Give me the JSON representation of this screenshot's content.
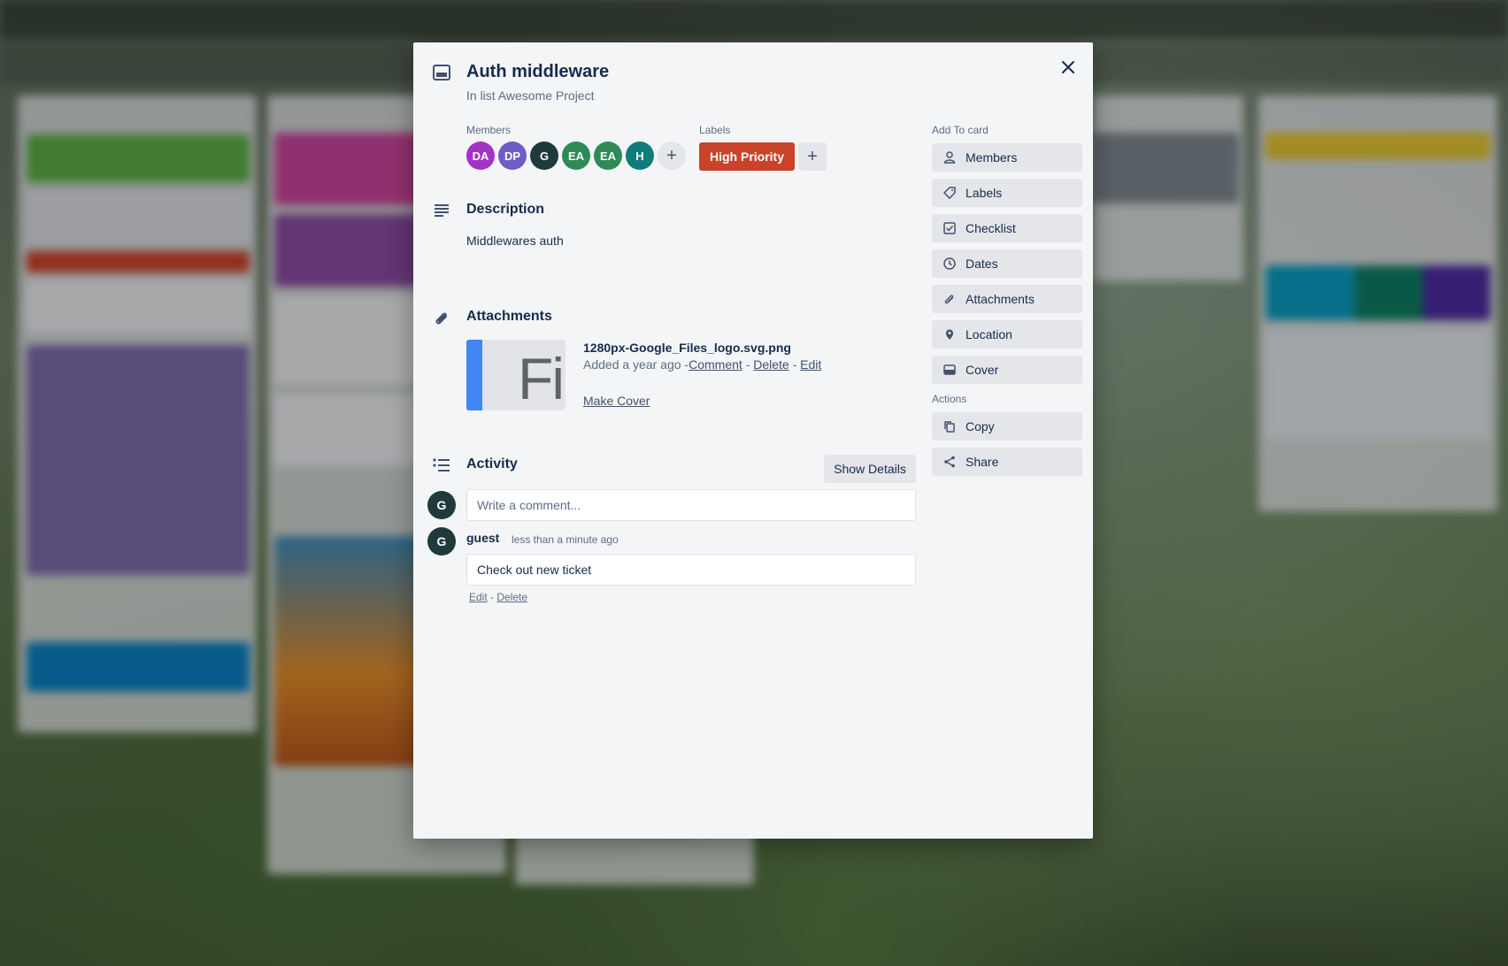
{
  "card": {
    "title": "Auth middleware",
    "list_prefix": "In list ",
    "list_name": "Awesome Project"
  },
  "members": {
    "label": "Members",
    "items": [
      {
        "initials": "DA",
        "color": "#a333c8"
      },
      {
        "initials": "DP",
        "color": "#6e5dc6"
      },
      {
        "initials": "G",
        "color": "#1f3a3a"
      },
      {
        "initials": "EA",
        "color": "#2e8b57"
      },
      {
        "initials": "EA",
        "color": "#2e8b57"
      },
      {
        "initials": "H",
        "color": "#0e7c7b"
      }
    ],
    "add": "+"
  },
  "labels": {
    "label": "Labels",
    "items": [
      {
        "text": "High Priority",
        "color": "#c9432a"
      }
    ],
    "add": "+"
  },
  "description": {
    "heading": "Description",
    "text": "Middlewares auth"
  },
  "attachments": {
    "heading": "Attachments",
    "thumb_text": "Fi",
    "file_name": "1280px-Google_Files_logo.svg.png",
    "added": "Added a year ago -",
    "comment": "Comment",
    "sep1": " - ",
    "delete": "Delete",
    "sep2": " - ",
    "edit": "Edit",
    "make_cover": "Make Cover"
  },
  "activity": {
    "heading": "Activity",
    "show_details": "Show Details",
    "user_initial": "G",
    "comment_placeholder": "Write a comment...",
    "comments": [
      {
        "initial": "G",
        "author": "guest",
        "time": "less than a minute ago",
        "text": "Check out new ticket",
        "edit": "Edit",
        "sep": " - ",
        "delete": "Delete"
      }
    ]
  },
  "sidebar": {
    "add_heading": "Add To card",
    "add_items": [
      "Members",
      "Labels",
      "Checklist",
      "Dates",
      "Attachments",
      "Location",
      "Cover"
    ],
    "actions_heading": "Actions",
    "action_items": [
      "Copy",
      "Share"
    ]
  }
}
